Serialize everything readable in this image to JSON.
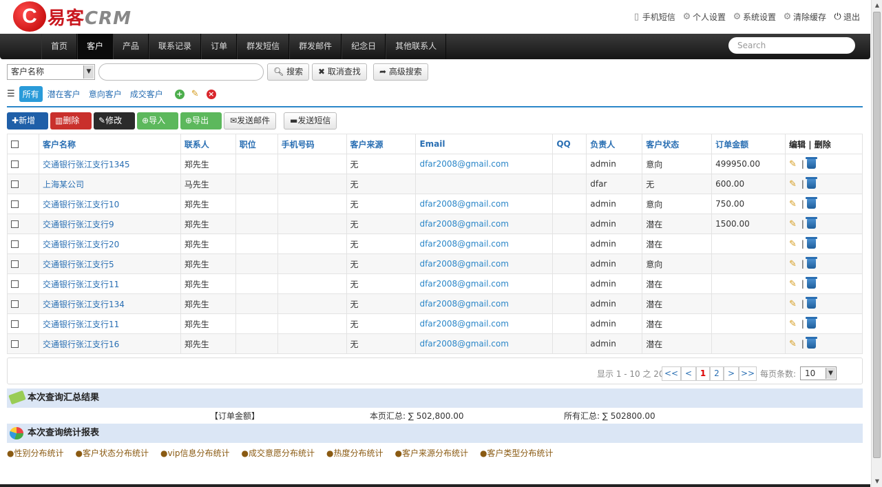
{
  "header": {
    "logo_letter": "C",
    "logo_text": "易客",
    "logo_text_en": "CRM",
    "links": [
      {
        "label": "手机短信",
        "icon": "phone-icon"
      },
      {
        "label": "个人设置",
        "icon": "gear-icon"
      },
      {
        "label": "系统设置",
        "icon": "gear-icon"
      },
      {
        "label": "清除缓存",
        "icon": "gear-icon"
      },
      {
        "label": "退出",
        "icon": "power-icon"
      }
    ]
  },
  "nav": {
    "items": [
      "首页",
      "客户",
      "产品",
      "联系记录",
      "订单",
      "群发短信",
      "群发邮件",
      "纪念日",
      "其他联系人"
    ],
    "active": "客户",
    "search_placeholder": "Search"
  },
  "search": {
    "field_select": "客户名称",
    "query": "",
    "search_btn": "搜索",
    "cancel_btn": "取消查找",
    "advanced_btn": "高级搜索"
  },
  "filters": {
    "items": [
      "所有",
      "潜在客户",
      "意向客户",
      "成交客户"
    ],
    "active": "所有"
  },
  "actions": {
    "new": "新增",
    "delete": "删除",
    "edit": "修改",
    "import": "导入",
    "export": "导出",
    "send_email": "发送邮件",
    "send_sms": "发送短信"
  },
  "table": {
    "columns": [
      "客户名称",
      "联系人",
      "职位",
      "手机号码",
      "客户来源",
      "Email",
      "QQ",
      "负责人",
      "客户状态",
      "订单金额",
      "编辑 | 删除"
    ],
    "rows": [
      [
        "交通银行张江支行1345",
        "郑先生",
        "",
        "",
        "无",
        "dfar2008@gmail.com",
        "",
        "admin",
        "意向",
        "499950.00"
      ],
      [
        "上海某公司",
        "马先生",
        "",
        "",
        "无",
        "",
        "",
        "dfar",
        "无",
        "600.00"
      ],
      [
        "交通银行张江支行10",
        "郑先生",
        "",
        "",
        "无",
        "dfar2008@gmail.com",
        "",
        "admin",
        "意向",
        "750.00"
      ],
      [
        "交通银行张江支行9",
        "郑先生",
        "",
        "",
        "无",
        "dfar2008@gmail.com",
        "",
        "admin",
        "潜在",
        "1500.00"
      ],
      [
        "交通银行张江支行20",
        "郑先生",
        "",
        "",
        "无",
        "dfar2008@gmail.com",
        "",
        "admin",
        "潜在",
        ""
      ],
      [
        "交通银行张江支行5",
        "郑先生",
        "",
        "",
        "无",
        "dfar2008@gmail.com",
        "",
        "admin",
        "意向",
        ""
      ],
      [
        "交通银行张江支行11",
        "郑先生",
        "",
        "",
        "无",
        "dfar2008@gmail.com",
        "",
        "admin",
        "潜在",
        ""
      ],
      [
        "交通银行张江支行134",
        "郑先生",
        "",
        "",
        "无",
        "dfar2008@gmail.com",
        "",
        "admin",
        "潜在",
        ""
      ],
      [
        "交通银行张江支行11",
        "郑先生",
        "",
        "",
        "无",
        "dfar2008@gmail.com",
        "",
        "admin",
        "潜在",
        ""
      ],
      [
        "交通银行张江支行16",
        "郑先生",
        "",
        "",
        "无",
        "dfar2008@gmail.com",
        "",
        "admin",
        "潜在",
        ""
      ]
    ]
  },
  "pager": {
    "info": "显示 1 - 10 之 20",
    "first": "<<",
    "prev": "<",
    "pages": [
      "1",
      "2"
    ],
    "current": "1",
    "next": ">",
    "last": ">>",
    "per_page_label": "每页条数:",
    "per_page": "10"
  },
  "summary": {
    "title": "本次查询汇总结果",
    "field": "【订单金额】",
    "page_total": "本页汇总: ∑ 502,800.00",
    "all_total": "所有汇总: ∑ 502800.00"
  },
  "stats": {
    "title": "本次查询统计报表",
    "links": [
      "●性别分布统计",
      "●客户状态分布统计",
      "●vip信息分布统计",
      "●成交意愿分布统计",
      "●热度分布统计",
      "●客户来源分布统计",
      "●客户类型分布统计"
    ]
  },
  "colors": {
    "accent": "#2a86c8",
    "nav_bg": "#1f1f1f",
    "btn_new": "#1f5fa8",
    "btn_delete": "#c9302c",
    "btn_edit": "#2b2b2b",
    "btn_import": "#5cb85c",
    "summary_bg": "#dbe6f5"
  }
}
